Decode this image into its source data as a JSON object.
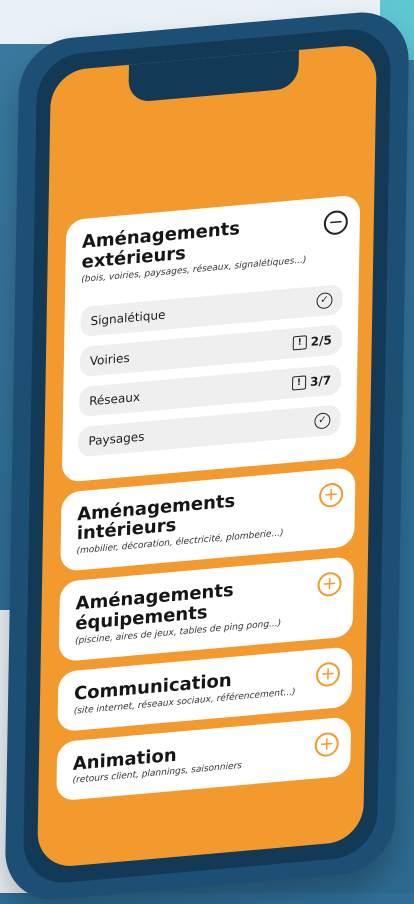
{
  "cards": [
    {
      "title": "Aménagements extérieurs",
      "subtitle": "(bois, voiries, paysages, réseaux, signalétiques...)",
      "state": "expanded",
      "items": [
        {
          "label": "Signalétique",
          "status_icon": "check-icon",
          "status_text": ""
        },
        {
          "label": "Voiries",
          "status_icon": "info-square-icon",
          "status_text": "2/5"
        },
        {
          "label": "Réseaux",
          "status_icon": "info-square-icon",
          "status_text": "3/7"
        },
        {
          "label": "Paysages",
          "status_icon": "check-icon",
          "status_text": ""
        }
      ]
    },
    {
      "title": "Aménagements intérieurs",
      "subtitle": "(mobilier, décoration, électricité, plomberie...)",
      "state": "collapsed"
    },
    {
      "title": "Aménagements équipements",
      "subtitle": "(piscine, aires de jeux, tables de ping pong...)",
      "state": "collapsed"
    },
    {
      "title": "Communication",
      "subtitle": "(site internet, réseaux sociaux, référencement...)",
      "state": "collapsed"
    },
    {
      "title": "Animation",
      "subtitle": "(retours client, plannings, saisonniers",
      "state": "collapsed"
    }
  ],
  "icons": {
    "expand": "plus-circle-icon",
    "collapse": "minus-circle-icon"
  },
  "colors": {
    "screen": "#f39a2f",
    "phone_shell": "#1d4e73",
    "background": "#2f6f97"
  }
}
